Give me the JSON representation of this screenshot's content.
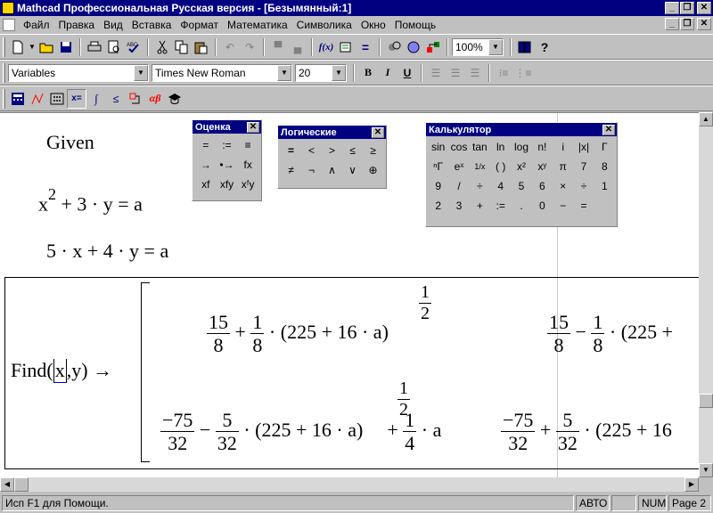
{
  "titlebar": {
    "title": "Mathcad Профессиональная Русская версия - [Безымянный:1]"
  },
  "window_controls": {
    "minimize": "_",
    "restore": "❐",
    "close": "✕"
  },
  "menu": [
    "Файл",
    "Правка",
    "Вид",
    "Вставка",
    "Формат",
    "Математика",
    "Символика",
    "Окно",
    "Помощь"
  ],
  "toolbar_standard": {
    "zoom": "100%"
  },
  "toolbar_format": {
    "style": "Variables",
    "font": "Times New Roman",
    "size": "20",
    "bold": "B",
    "italic": "I",
    "underline": "U"
  },
  "toolbar_math": {
    "greek": "αβ"
  },
  "worksheet": {
    "given": "Given",
    "eq1": {
      "x": "x",
      "exp": "2",
      "rest": "+ 3 · y = a"
    },
    "eq2": "5 · x + 4 · y = a",
    "find": {
      "prefix": "Find(",
      "var1": "x",
      "rest": ",y)",
      "arrow": "→"
    },
    "result": {
      "r1c1": {
        "n1": "15",
        "d1": "8",
        "op1": "+",
        "n2": "1",
        "d2": "8",
        "mid": "· (225 + 16 · a)",
        "en": "1",
        "ed": "2"
      },
      "r1c2": {
        "n1": "15",
        "d1": "8",
        "op1": "−",
        "n2": "1",
        "d2": "8",
        "mid": "· (225 +"
      },
      "r2c1": {
        "n1": "−75",
        "d1": "32",
        "op1": "−",
        "n2": "5",
        "d2": "32",
        "mid": "· (225 + 16 · a)",
        "en": "1",
        "ed": "2",
        "op2": "+",
        "n3": "1",
        "d3": "4",
        "tail": "· a"
      },
      "r2c2": {
        "n1": "−75",
        "d1": "32",
        "op1": "+",
        "n2": "5",
        "d2": "32",
        "mid": "· (225 + 16"
      }
    }
  },
  "palettes": {
    "ocenka": {
      "title": "Оценка",
      "close": "✕",
      "buttons": [
        "=",
        ":=",
        "≡",
        "→",
        "•→",
        "fx",
        "xf",
        "xfy",
        "xᶠy"
      ]
    },
    "logic": {
      "title": "Логические",
      "close": "✕",
      "buttons": [
        "=",
        "<",
        ">",
        "≤",
        "≥",
        "≠",
        "¬",
        "∧",
        "∨",
        "⊕"
      ]
    },
    "calc": {
      "title": "Калькулятор",
      "close": "✕",
      "buttons": [
        "sin",
        "cos",
        "tan",
        "ln",
        "log",
        "n!",
        "i",
        "|x|",
        "Γ",
        "ⁿΓ",
        "eˣ",
        "1/x",
        "( )",
        "x²",
        "xʸ",
        "π",
        "7",
        "8",
        "9",
        "/",
        "÷",
        "4",
        "5",
        "6",
        "×",
        "÷",
        "1",
        "2",
        "3",
        "+",
        ":=",
        ".",
        "0",
        "−",
        "="
      ]
    }
  },
  "status": {
    "help": "Исп F1 для Помощи.",
    "mode": "АВТО",
    "blank": "",
    "num": "NUM",
    "page": "Page 2"
  }
}
